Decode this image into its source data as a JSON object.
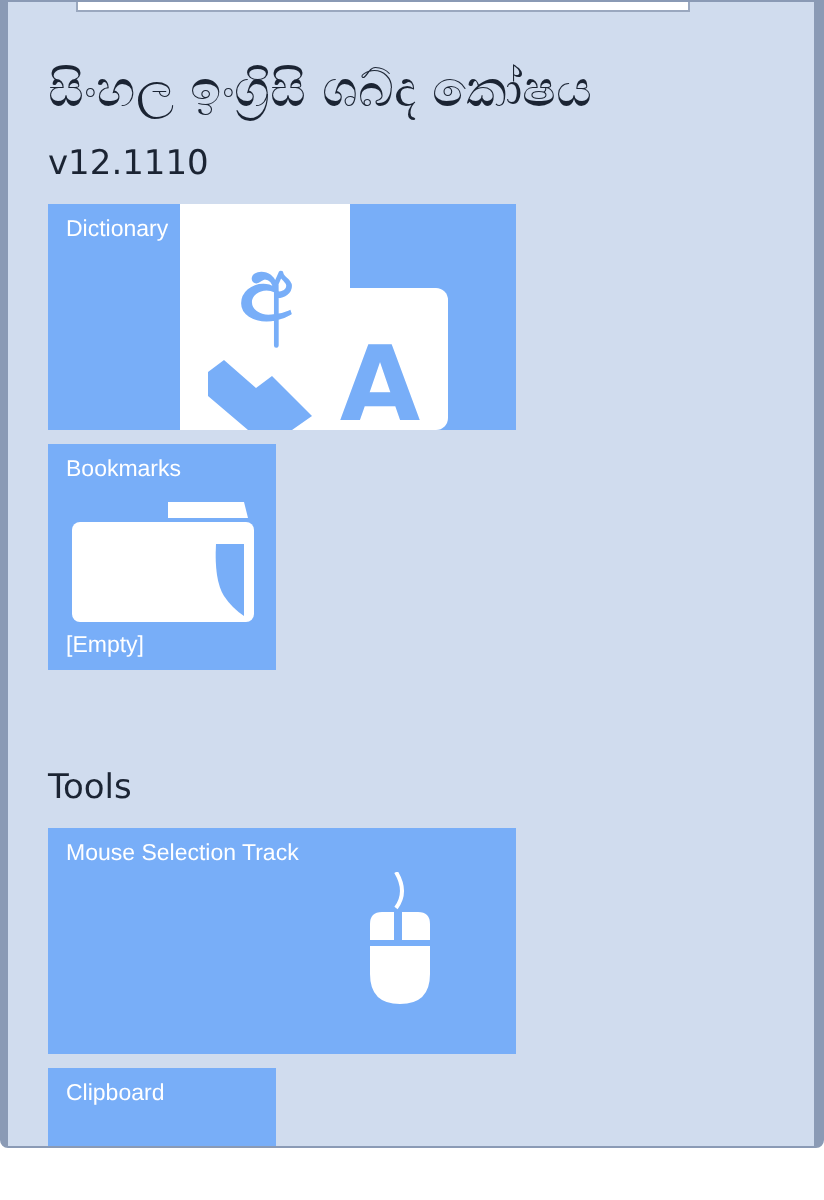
{
  "app": {
    "title": "සිංහල ඉංග්‍රිසි ශබ්ද කෝෂය",
    "version": "v12.1110"
  },
  "tiles": [
    {
      "kind": "dictionary",
      "label": "Dictionary",
      "glyphs": [
        "අ",
        "A"
      ]
    },
    {
      "kind": "bookmarks",
      "label": "Bookmarks",
      "footer": "[Empty]"
    }
  ],
  "tools": {
    "heading": "Tools",
    "tiles": [
      {
        "kind": "mouse",
        "label": "Mouse Selection Track"
      },
      {
        "kind": "clipboard",
        "label": "Clipboard"
      }
    ]
  }
}
